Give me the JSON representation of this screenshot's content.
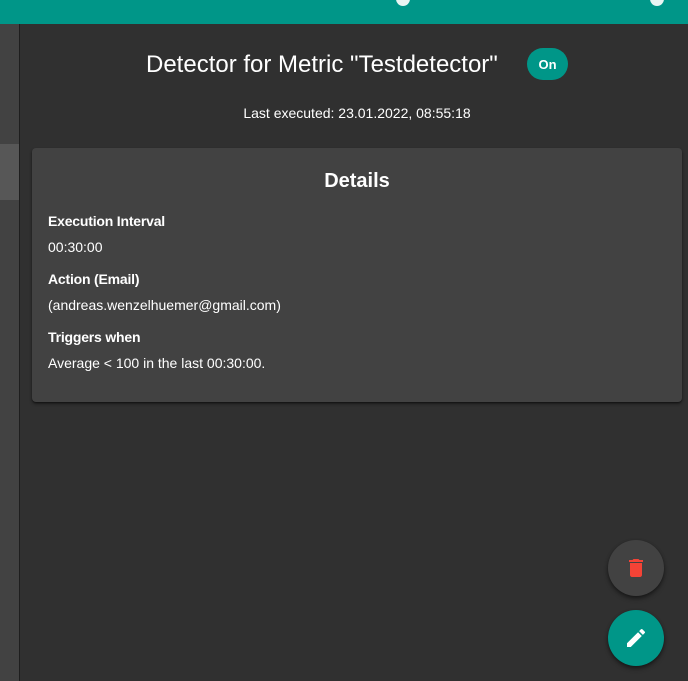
{
  "detector": {
    "title": "Detector for Metric \"Testdetector\"",
    "status_label": "On",
    "last_executed": "Last executed: 23.01.2022, 08:55:18"
  },
  "details": {
    "title": "Details",
    "fields": [
      {
        "label": "Execution Interval",
        "value": "00:30:00"
      },
      {
        "label": "Action (Email)",
        "value": "(andreas.wenzelhuemer@gmail.com)"
      },
      {
        "label": "Triggers when",
        "value": "Average < 100 in the last 00:30:00."
      }
    ]
  },
  "actions": {
    "delete_icon": "trash-icon",
    "edit_icon": "pencil-icon"
  },
  "colors": {
    "primary": "#009688",
    "background": "#303030",
    "card": "#424242",
    "delete": "#f44336"
  }
}
